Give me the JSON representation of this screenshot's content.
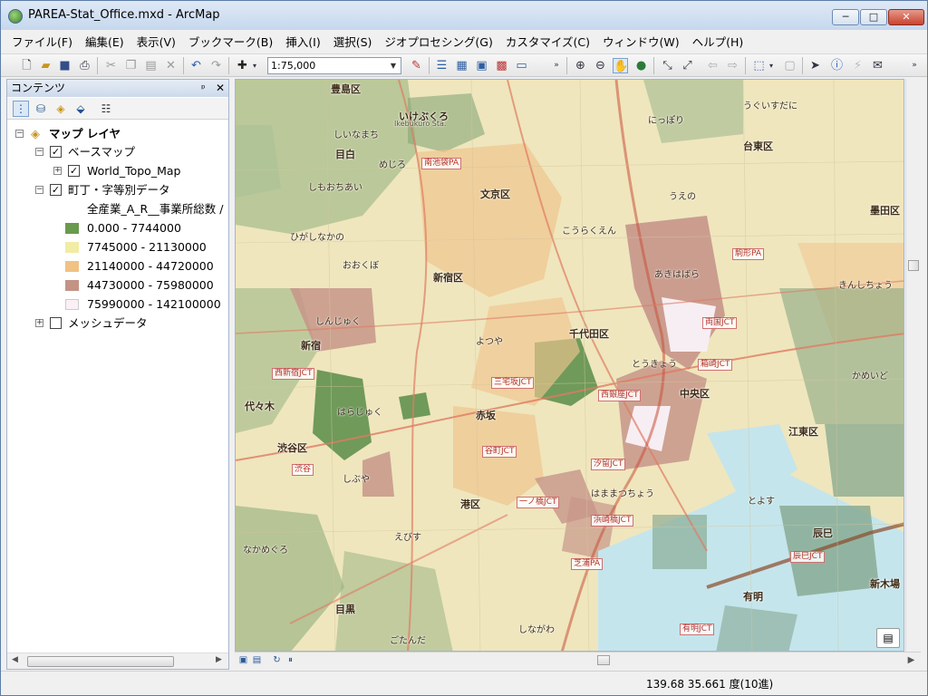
{
  "window": {
    "title": "PAREA-Stat_Office.mxd - ArcMap",
    "minimize": "─",
    "maximize": "□",
    "close": "✕"
  },
  "menu": [
    "ファイル(F)",
    "編集(E)",
    "表示(V)",
    "ブックマーク(B)",
    "挿入(I)",
    "選択(S)",
    "ジオプロセシング(G)",
    "カスタマイズ(C)",
    "ウィンドウ(W)",
    "ヘルプ(H)"
  ],
  "toolbar": {
    "scale": "1:75,000"
  },
  "toc": {
    "title": "コンテンツ",
    "pin": "ᵖ",
    "close": "✕",
    "root": "マップ レイヤ",
    "basemap_group": "ベースマップ",
    "basemap_layer": "World_Topo_Map",
    "data_layer": "町丁・字等別データ",
    "field_label": "全産業_A_R__事業所総数 /",
    "classes": [
      {
        "label": "0.000 - 7744000",
        "color": "#6a9a4e"
      },
      {
        "label": "7745000 - 21130000",
        "color": "#f2eca4"
      },
      {
        "label": "21140000 - 44720000",
        "color": "#f0c283"
      },
      {
        "label": "44730000 - 75980000",
        "color": "#c39386"
      },
      {
        "label": "75990000 - 142100000",
        "color": "#faf0f6"
      }
    ],
    "mesh_layer": "メッシュデータ"
  },
  "map": {
    "labels": {
      "toshima": "豊島区",
      "ikebukuro": "いけぶくろ",
      "ikebukuro_en": "Ikebukuro Sta.",
      "shinomachi": "しいなまち",
      "mejiro": "めじろ",
      "mejiro_k": "目白",
      "shimoochiai": "しもおちあい",
      "higashinakano": "ひがしなかの",
      "okubo": "おおくぼ",
      "shinjuku_ku": "新宿区",
      "shinjuku": "しんじゅく",
      "shinjuku_k": "新宿",
      "yoyogi": "代々木",
      "harajuku": "はらじゅく",
      "shibuya_ku": "渋谷区",
      "shibuya": "しぶや",
      "ebisu": "えびす",
      "nakameguro": "なかめぐろ",
      "meguro": "目黒",
      "gotanda": "ごたんだ",
      "bunkyo": "文京区",
      "korakuen": "こうらくえん",
      "yotsuya": "よつや",
      "akasaka": "赤坂",
      "chiyoda": "千代田区",
      "tokyo": "とうきょう",
      "akihabara": "あきはばら",
      "ueno": "うえの",
      "taito": "台東区",
      "chuo": "中央区",
      "minato": "港区",
      "hamamatsucho": "はままつちょう",
      "shinagawa": "しながわ",
      "toyosu": "とよす",
      "koto": "江東区",
      "ariake": "有明",
      "tatsumi": "辰巳",
      "shinkiba": "新木場",
      "kameido": "かめいど",
      "sumida": "墨田区",
      "nippori": "にっぽり",
      "uguisudani": "うぐいすだに",
      "kinshicho": "きんしちょう"
    },
    "jcts": {
      "minami_ikebukuro": "南池袋PA",
      "nishishinjuku": "西新宿JCT",
      "sangenjaya": "三宅坂JCT",
      "nishiginza": "西銀座JCT",
      "edobashi": "両国JCT",
      "hakozaki": "箱崎JCT",
      "shiodome": "汐留JCT",
      "hamazakibashi": "浜崎橋JCT",
      "ichinohashi": "一ノ橋JCT",
      "tanimachi": "谷町JCT",
      "tatsumi_jct": "辰巳JCT",
      "ariake_jct": "有明JCT",
      "shibaura": "芝浦PA",
      "komagata": "駒形PA",
      "shibuya_jct": "渋谷"
    }
  },
  "status": {
    "coords": "139.68  35.661 度(10進)"
  }
}
